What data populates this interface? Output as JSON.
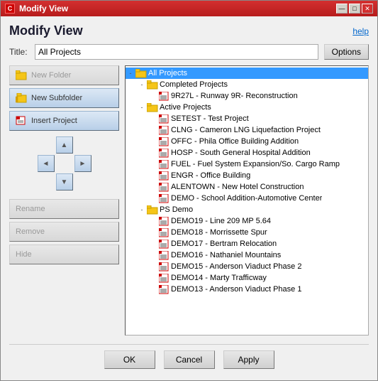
{
  "window": {
    "title": "Modify View",
    "icon": "C",
    "controls": {
      "minimize": "—",
      "maximize": "□",
      "close": "✕"
    }
  },
  "header": {
    "title": "Modify View",
    "help_label": "help"
  },
  "title_field": {
    "label": "Title:",
    "value": "All Projects",
    "options_label": "Options"
  },
  "buttons": {
    "new_folder": "New Folder",
    "new_subfolder": "New Subfolder",
    "insert_project": "Insert Project",
    "rename": "Rename",
    "remove": "Remove",
    "hide": "Hide"
  },
  "tree": {
    "items": [
      {
        "id": "all-projects",
        "label": "All Projects",
        "level": 0,
        "type": "folder",
        "selected": true,
        "expand": "-"
      },
      {
        "id": "completed",
        "label": "Completed Projects",
        "level": 1,
        "type": "folder",
        "expand": "-"
      },
      {
        "id": "9R27L",
        "label": "9R27L - Runway 9R- Reconstruction",
        "level": 2,
        "type": "project",
        "expand": ""
      },
      {
        "id": "active",
        "label": "Active Projects",
        "level": 1,
        "type": "folder",
        "expand": "-"
      },
      {
        "id": "setest",
        "label": "SETEST - Test Project",
        "level": 2,
        "type": "project",
        "expand": ""
      },
      {
        "id": "clng",
        "label": "CLNG - Cameron LNG Liquefaction Project",
        "level": 2,
        "type": "project",
        "expand": ""
      },
      {
        "id": "offc",
        "label": "OFFC - Phila Office Building Addition",
        "level": 2,
        "type": "project",
        "expand": ""
      },
      {
        "id": "hosp",
        "label": "HOSP - South General Hospital Addition",
        "level": 2,
        "type": "project",
        "expand": ""
      },
      {
        "id": "fuel",
        "label": "FUEL - Fuel System Expansion/So. Cargo Ramp",
        "level": 2,
        "type": "project",
        "expand": ""
      },
      {
        "id": "engr",
        "label": "ENGR - Office Building",
        "level": 2,
        "type": "project",
        "expand": ""
      },
      {
        "id": "alentown",
        "label": "ALENTOWN - New Hotel Construction",
        "level": 2,
        "type": "project",
        "expand": ""
      },
      {
        "id": "demo-school",
        "label": "DEMO - School Addition-Automotive Center",
        "level": 2,
        "type": "project",
        "expand": ""
      },
      {
        "id": "ps-demo",
        "label": "PS Demo",
        "level": 1,
        "type": "folder",
        "expand": "-"
      },
      {
        "id": "demo19",
        "label": "DEMO19 - Line 209 MP 5.64",
        "level": 2,
        "type": "project",
        "expand": ""
      },
      {
        "id": "demo18",
        "label": "DEMO18 - Morrissette Spur",
        "level": 2,
        "type": "project",
        "expand": ""
      },
      {
        "id": "demo17",
        "label": "DEMO17 - Bertram Relocation",
        "level": 2,
        "type": "project",
        "expand": ""
      },
      {
        "id": "demo16",
        "label": "DEMO16 - Nathaniel Mountains",
        "level": 2,
        "type": "project",
        "expand": ""
      },
      {
        "id": "demo15",
        "label": "DEMO15 - Anderson Viaduct Phase 2",
        "level": 2,
        "type": "project",
        "expand": ""
      },
      {
        "id": "demo14",
        "label": "DEMO14 - Marty Trafficway",
        "level": 2,
        "type": "project",
        "expand": ""
      },
      {
        "id": "demo13",
        "label": "DEMO13 - Anderson Viaduct Phase 1",
        "level": 2,
        "type": "project",
        "expand": ""
      }
    ]
  },
  "footer": {
    "ok_label": "OK",
    "cancel_label": "Cancel",
    "apply_label": "Apply"
  }
}
